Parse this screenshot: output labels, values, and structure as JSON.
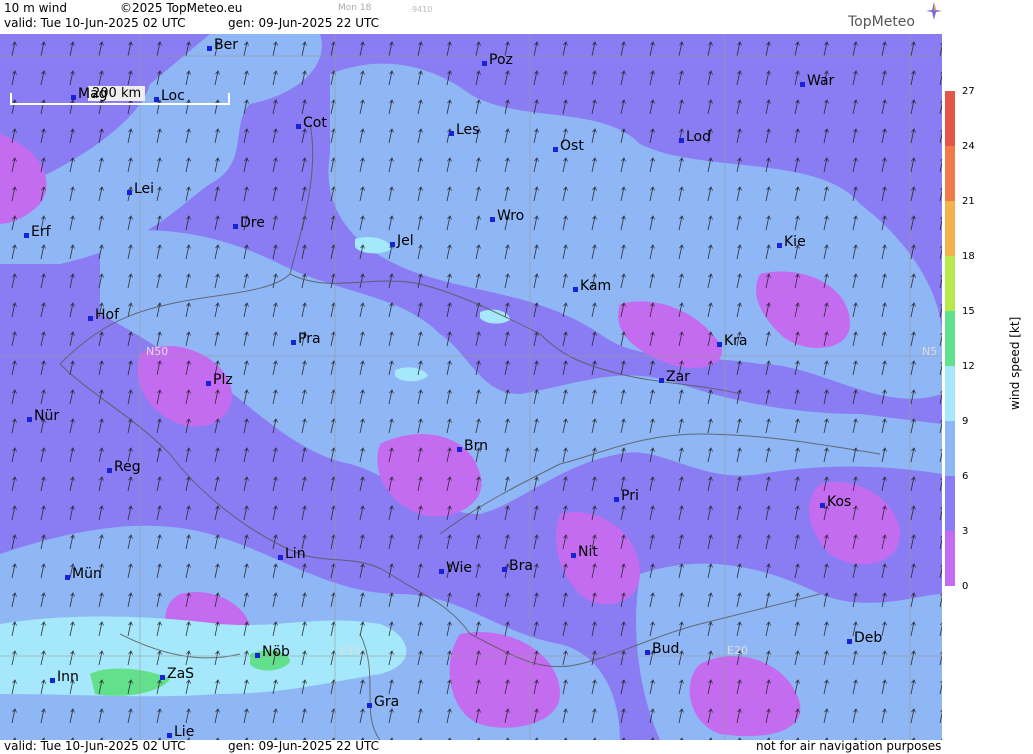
{
  "header": {
    "product": "10 m wind",
    "copyright": "©2025 TopMeteo.eu",
    "model_run_day": "Mon 18",
    "code": "9410",
    "valid": "valid:  Tue  10-Jun-2025  02 UTC",
    "generated": "gen: 09-Jun-2025 22 UTC",
    "logo": "TopMeteo"
  },
  "footer": {
    "valid": "valid:  Tue  10-Jun-2025  02 UTC",
    "generated": "gen: 09-Jun-2025 22 UTC",
    "disclaimer": "not for air navigation purposes"
  },
  "scale": {
    "label": "200 km"
  },
  "grid_labels": [
    "N50",
    "N5",
    "E15",
    "E20"
  ],
  "legend": {
    "title": "wind speed [kt]",
    "ticks": [
      "27",
      "24",
      "21",
      "18",
      "15",
      "12",
      "9",
      "6",
      "3",
      "0"
    ],
    "colors": [
      "#c46cf0",
      "#8a7cf2",
      "#8fb6f5",
      "#a6e8fb",
      "#63e08c",
      "#a3ea55",
      "#e0e43c",
      "#f4b34a",
      "#f07a4a",
      "#e4564a"
    ]
  },
  "cities": [
    {
      "name": "Ber"
    },
    {
      "name": "Poz"
    },
    {
      "name": "War"
    },
    {
      "name": "Mag"
    },
    {
      "name": "Loc"
    },
    {
      "name": "Cot"
    },
    {
      "name": "Les"
    },
    {
      "name": "Ost"
    },
    {
      "name": "Lod"
    },
    {
      "name": "Lei"
    },
    {
      "name": "Erf"
    },
    {
      "name": "Dre"
    },
    {
      "name": "Wro"
    },
    {
      "name": "Jel"
    },
    {
      "name": "Kie"
    },
    {
      "name": "Kam"
    },
    {
      "name": "Hof"
    },
    {
      "name": "Pra"
    },
    {
      "name": "Kra"
    },
    {
      "name": "Plz"
    },
    {
      "name": "Zar"
    },
    {
      "name": "Nür"
    },
    {
      "name": "Brn"
    },
    {
      "name": "Reg"
    },
    {
      "name": "Pri"
    },
    {
      "name": "Kos"
    },
    {
      "name": "Lin"
    },
    {
      "name": "Nit"
    },
    {
      "name": "Wie"
    },
    {
      "name": "Bra"
    },
    {
      "name": "Mün"
    },
    {
      "name": "Deb"
    },
    {
      "name": "Nöb"
    },
    {
      "name": "Bud"
    },
    {
      "name": "Inn"
    },
    {
      "name": "ZaS"
    },
    {
      "name": "Gra"
    },
    {
      "name": "Lie"
    }
  ]
}
